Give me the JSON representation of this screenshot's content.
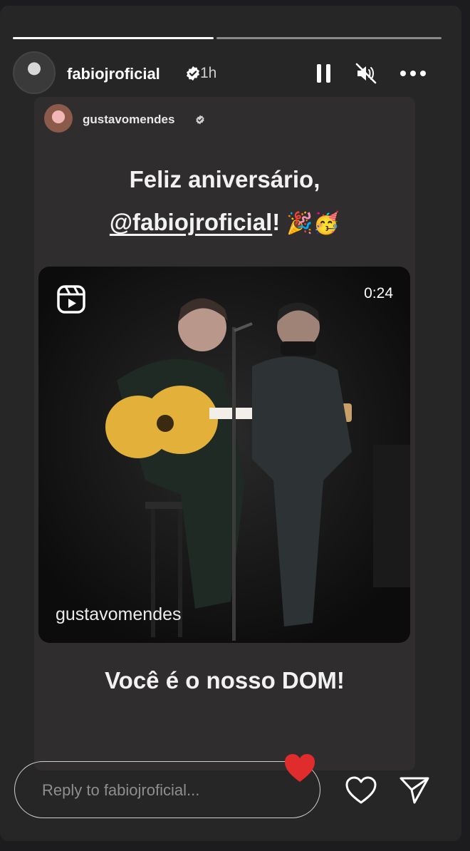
{
  "story": {
    "progress_done": 0.47,
    "segments": 2
  },
  "header": {
    "username": "fabiojroficial",
    "time": "1h"
  },
  "card": {
    "username": "gustavomendes",
    "greeting_line1": "Feliz aniversário,",
    "greeting_mention": "@fabiojroficial",
    "greeting_end": "!",
    "greeting_emoji": "🎉🥳",
    "video": {
      "duration": "0:24",
      "username": "gustavomendes"
    },
    "caption": "Você é o nosso DOM!"
  },
  "footer": {
    "reply_placeholder": "Reply to fabiojroficial..."
  },
  "colors": {
    "background": "#262626",
    "card": "#2f2d2e",
    "verified": "#ffffff",
    "heart": "#e02c2c"
  },
  "icons": [
    "pause-icon",
    "mute-icon",
    "more-icon",
    "verified-icon",
    "reels-icon",
    "heart-icon",
    "send-icon"
  ]
}
